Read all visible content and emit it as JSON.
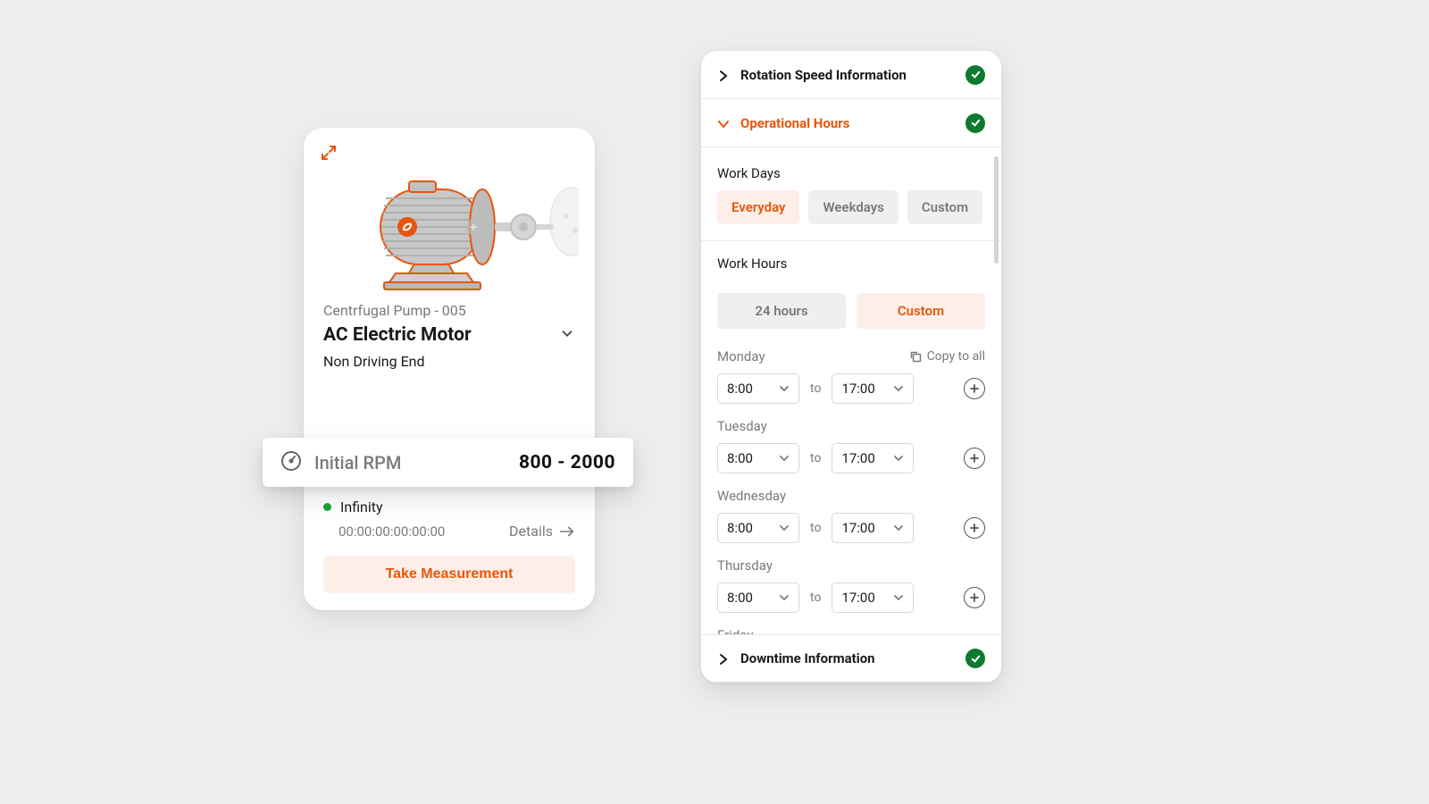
{
  "motor_card": {
    "asset_id": "Centrfugal Pump - 005",
    "title": "AC Electric Motor",
    "subtitle": "Non Driving End",
    "rpm_label": "Initial RPM",
    "rpm_value": "800 - 2000",
    "infinity_label": "Infinity",
    "mac": "00:00:00:00:00:00",
    "details_label": "Details",
    "take_measurement_label": "Take Measurement"
  },
  "panel": {
    "acc1_title": "Rotation Speed Information",
    "acc2_title": "Operational Hours",
    "acc3_title": "Downtime Information",
    "workdays_label": "Work Days",
    "workdays_options": {
      "everyday": "Everyday",
      "weekdays": "Weekdays",
      "custom": "Custom"
    },
    "workhours_label": "Work Hours",
    "workhours_options": {
      "h24": "24 hours",
      "custom": "Custom"
    },
    "copy_to_all": "Copy to all",
    "to": "to",
    "days": [
      {
        "name": "Monday",
        "from": "8:00",
        "to": "17:00",
        "show_copy": true
      },
      {
        "name": "Tuesday",
        "from": "8:00",
        "to": "17:00"
      },
      {
        "name": "Wednesday",
        "from": "8:00",
        "to": "17:00"
      },
      {
        "name": "Thursday",
        "from": "8:00",
        "to": "17:00"
      },
      {
        "name": "Friday"
      }
    ]
  }
}
